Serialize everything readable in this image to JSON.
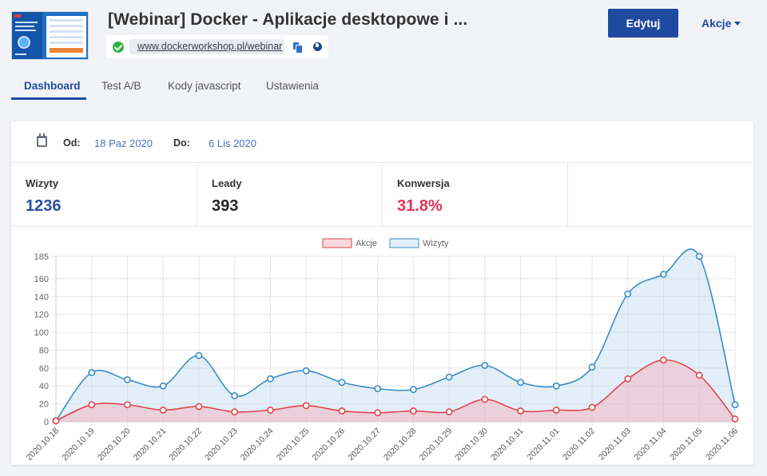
{
  "header": {
    "title": "[Webinar] Docker - Aplikacje desktopowe i ...",
    "url": "www.dockerworkshop.pl/webinar",
    "edit_label": "Edytuj",
    "actions_label": "Akcje",
    "thumbnail_icon": "landing-page-thumbnail"
  },
  "tabs": [
    {
      "label": "Dashboard",
      "active": true
    },
    {
      "label": "Test A/B",
      "active": false
    },
    {
      "label": "Kody javascript",
      "active": false
    },
    {
      "label": "Ustawienia",
      "active": false
    }
  ],
  "dates": {
    "from_label": "Od:",
    "from_value": "18 Paz 2020",
    "to_label": "Do:",
    "to_value": "6 Lis 2020"
  },
  "stats": [
    {
      "label": "Wizyty",
      "value": "1236",
      "color": "#2a4ea3"
    },
    {
      "label": "Leady",
      "value": "393",
      "color": "#222222"
    },
    {
      "label": "Konwersja",
      "value": "31.8%",
      "color": "#e0345a"
    }
  ],
  "colors": {
    "accent": "#1f4aa1",
    "status_ok": "#2fb344"
  },
  "chart_data": {
    "type": "area",
    "legend_position": "top",
    "grid": true,
    "ylim": [
      0,
      185
    ],
    "yticks": [
      0,
      20,
      40,
      60,
      80,
      100,
      120,
      140,
      160,
      185
    ],
    "categories": [
      "2020.10.18",
      "2020.10.19",
      "2020.10.20",
      "2020.10.21",
      "2020.10.22",
      "2020.10.23",
      "2020.10.24",
      "2020.10.25",
      "2020.10.26",
      "2020.10.27",
      "2020.10.28",
      "2020.10.29",
      "2020.10.30",
      "2020.10.31",
      "2020.11.01",
      "2020.11.02",
      "2020.11.03",
      "2020.11.04",
      "2020.11.05",
      "2020.11.06"
    ],
    "series": [
      {
        "name": "Akcje",
        "color": "#e0464d",
        "fill": "rgba(244,170,185,0.45)",
        "values": [
          1,
          19,
          19,
          13,
          17,
          11,
          13,
          18,
          12,
          10,
          12,
          11,
          25,
          12,
          13,
          16,
          48,
          69,
          52,
          3
        ]
      },
      {
        "name": "Wizyty",
        "color": "#3a8dc6",
        "fill": "rgba(186,214,238,0.40)",
        "values": [
          1,
          55,
          47,
          40,
          74,
          29,
          48,
          57,
          44,
          37,
          36,
          50,
          63,
          44,
          40,
          61,
          143,
          165,
          185,
          19
        ]
      }
    ]
  }
}
